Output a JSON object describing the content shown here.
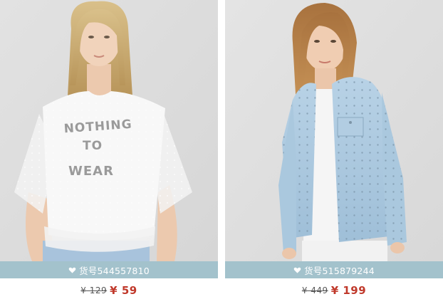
{
  "products": [
    {
      "shirt_text": [
        "NOTHING",
        "TO",
        "WEAR"
      ],
      "code_label": "货号544557810",
      "old_price": "¥ 129",
      "new_price": "¥ 59"
    },
    {
      "code_label": "货号515879244",
      "old_price": "¥ 449",
      "new_price": "¥ 199"
    }
  ],
  "colors": {
    "code_bar": "#a3c2cc",
    "new_price": "#c0392b",
    "old_price": "#555555"
  },
  "icons": {
    "code_bullet": "heart-icon"
  }
}
